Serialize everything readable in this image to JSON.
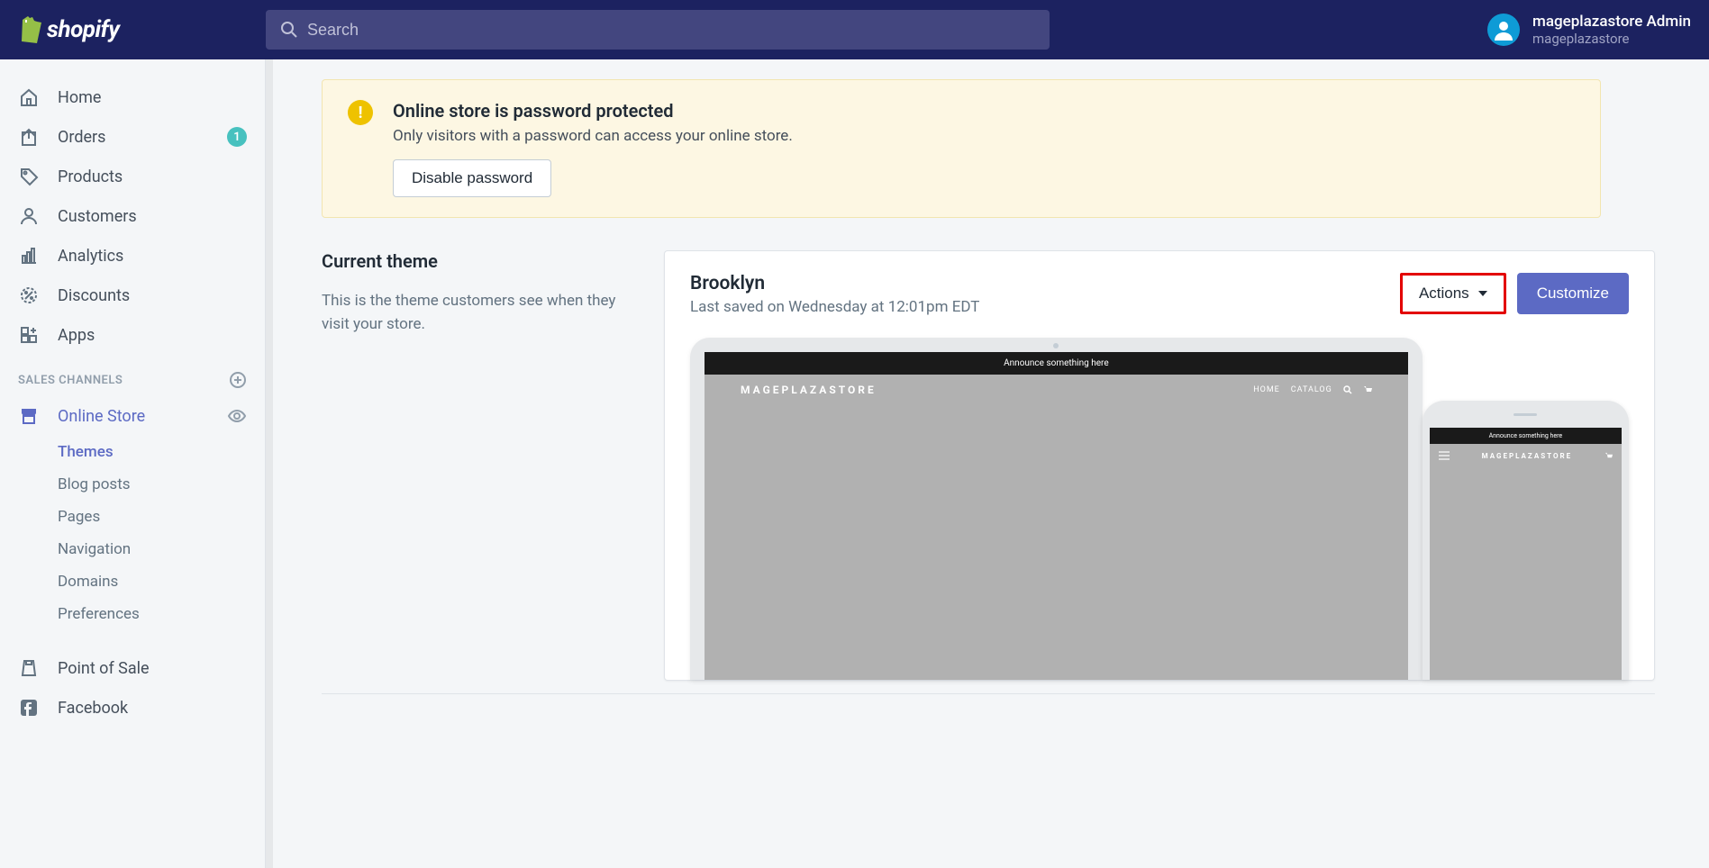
{
  "topbar": {
    "search_placeholder": "Search",
    "profile_name": "mageplazastore Admin",
    "profile_store": "mageplazastore"
  },
  "sidebar": {
    "items": [
      {
        "label": "Home"
      },
      {
        "label": "Orders",
        "badge": "1"
      },
      {
        "label": "Products"
      },
      {
        "label": "Customers"
      },
      {
        "label": "Analytics"
      },
      {
        "label": "Discounts"
      },
      {
        "label": "Apps"
      }
    ],
    "section_label": "SALES CHANNELS",
    "online_store_label": "Online Store",
    "sub_items": [
      {
        "label": "Themes"
      },
      {
        "label": "Blog posts"
      },
      {
        "label": "Pages"
      },
      {
        "label": "Navigation"
      },
      {
        "label": "Domains"
      },
      {
        "label": "Preferences"
      }
    ],
    "pos_label": "Point of Sale",
    "facebook_label": "Facebook"
  },
  "banner": {
    "title": "Online store is password protected",
    "desc": "Only visitors with a password can access your online store.",
    "button": "Disable password"
  },
  "theme": {
    "heading": "Current theme",
    "desc": "This is the theme customers see when they visit your store.",
    "name": "Brooklyn",
    "saved": "Last saved on Wednesday at 12:01pm EDT",
    "actions_label": "Actions",
    "customize_label": "Customize"
  },
  "preview": {
    "announce": "Announce something here",
    "store_name": "MAGEPLAZASTORE",
    "nav_home": "HOME",
    "nav_catalog": "CATALOG"
  }
}
